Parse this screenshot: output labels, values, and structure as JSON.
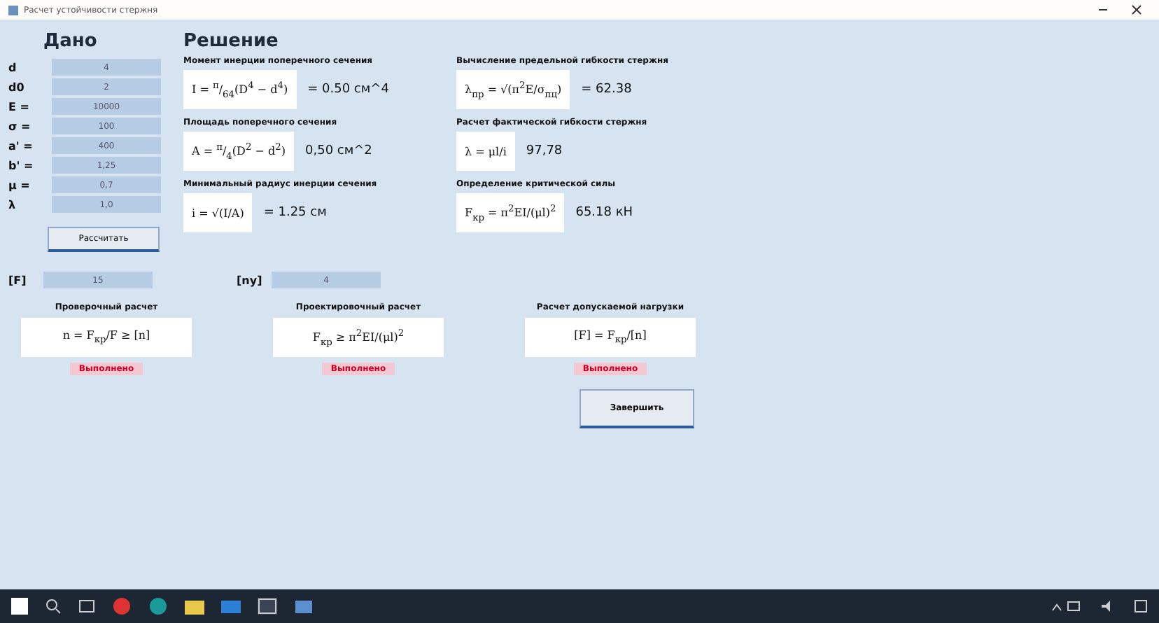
{
  "window": {
    "title": "Расчет устойчивости стержня"
  },
  "given": {
    "title": "Дано",
    "fields": [
      {
        "label": "d",
        "value": "4"
      },
      {
        "label": "d0",
        "value": "2"
      },
      {
        "label": "E =",
        "value": "10000"
      },
      {
        "label": "σ =",
        "value": "100"
      },
      {
        "label": "a' =",
        "value": "400"
      },
      {
        "label": "b' =",
        "value": "1,25"
      },
      {
        "label": "μ =",
        "value": "0,7"
      },
      {
        "label": "λ",
        "value": "1,0"
      }
    ],
    "button": "Рассчитать"
  },
  "solution": {
    "title": "Решение",
    "steps": [
      {
        "label": "Момент инерции поперечного сечения",
        "formula": "I = $^{π}$/$_{64}$(D$^{4}$ − d$^{4}$)",
        "result": "= 0.50 см^4"
      },
      {
        "label": "Площадь поперечного сечения",
        "formula": "A = $^{π}$/$_{4}$(D$^{2}$ − d$^{2}$)",
        "result": "0,50 см^2"
      },
      {
        "label": "Минимальный радиус инерции сечения",
        "formula": "i = √(I/A)",
        "result": "= 1.25 см"
      },
      {
        "label": "Вычисление предельной гибкости стержня",
        "formula": "λ$_{пр}$ = √(π$^{2}$E/σ$_{пц}$)",
        "result": "= 62.38"
      },
      {
        "label": "Расчет фактической гибкости стержня",
        "formula": "λ = μl/i",
        "result": "97,78"
      },
      {
        "label": "Определение критической силы",
        "formula": "F$_{кр}$ = π$^{2}$EI/(μl)$^{2}$",
        "result": "65.18 кН"
      }
    ]
  },
  "limits": [
    {
      "label": "[F]",
      "value": "15"
    },
    {
      "label": "[ny]",
      "value": "4"
    }
  ],
  "checks": [
    {
      "label": "Проверочный расчет",
      "formula": "n = F$_{кр}$/F ≥ [n]",
      "status": "Выполнено",
      "done": true
    },
    {
      "label": "Проектировочный расчет",
      "formula": "F$_{кр}$ ≥ π$^{2}$EI/(μl)$^{2}$",
      "status": "Выполнено",
      "done": true
    },
    {
      "label": "Расчет допускаемой нагрузки",
      "formula": "[F] = F$_{кр}$/[n]",
      "status": "Выполнено",
      "done": true
    }
  ],
  "close_button": "Завершить"
}
